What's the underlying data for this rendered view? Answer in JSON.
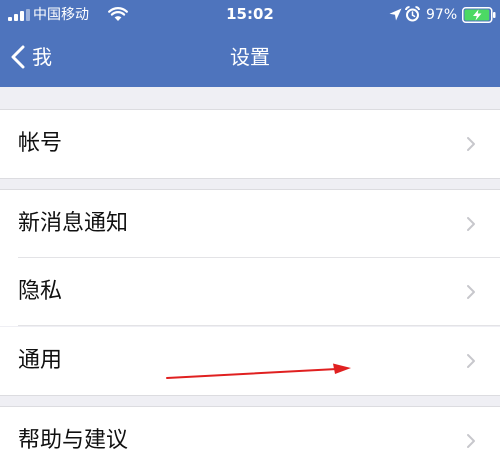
{
  "status_bar": {
    "carrier": "中国移动",
    "time": "15:02",
    "battery_percent": "97%",
    "battery_level": 0.97,
    "icons": [
      "signal-icon",
      "wifi-icon",
      "location-arrow-icon",
      "alarm-icon",
      "charging-battery-icon"
    ]
  },
  "navbar": {
    "back_label": "我",
    "title": "设置",
    "back_icon": "chevron-left-icon"
  },
  "settings": [
    {
      "label": "帐号",
      "icon": "chevron-right-icon"
    },
    {
      "label": "新消息通知",
      "icon": "chevron-right-icon"
    },
    {
      "label": "隐私",
      "icon": "chevron-right-icon"
    },
    {
      "label": "通用",
      "icon": "chevron-right-icon"
    },
    {
      "label": "帮助与建议",
      "icon": "chevron-right-icon"
    }
  ],
  "annotation": {
    "icon": "red-arrow-icon"
  },
  "colors": {
    "header": "#4e74bd",
    "background": "#efeff4",
    "row": "#ffffff",
    "chevron": "#c7c7cc",
    "annotation_arrow": "#e02020",
    "battery_fill": "#4cd964"
  }
}
